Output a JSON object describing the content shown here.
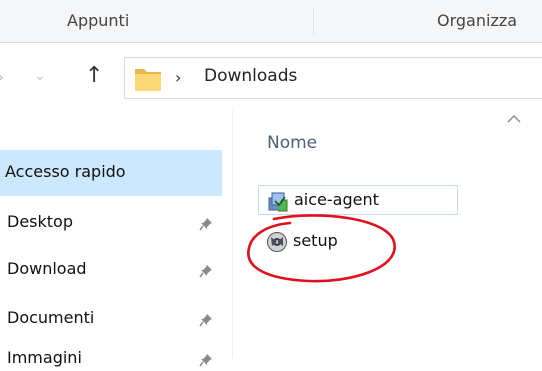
{
  "ribbon": {
    "tabs": [
      "Appunti",
      "Organizza"
    ]
  },
  "toolbar": {
    "back": "›",
    "forward": "⌄",
    "up": "↑"
  },
  "address": {
    "separator": "›",
    "path": "Downloads"
  },
  "nav": {
    "items": [
      {
        "label": "Accesso rapido",
        "selected": true,
        "pinned": false
      },
      {
        "label": "Desktop",
        "pinned": true
      },
      {
        "label": "Download",
        "pinned": true
      },
      {
        "label": "Documenti",
        "pinned": true
      },
      {
        "label": "Immagini",
        "pinned": true
      }
    ]
  },
  "files": {
    "column_name": "Nome",
    "sort_indicator": "^",
    "rows": [
      {
        "name": "aice-agent",
        "icon": "installer-package-icon"
      },
      {
        "name": "setup",
        "icon": "setup-disc-icon",
        "annotated": true
      }
    ]
  },
  "annotation": {
    "color": "#e0101e"
  }
}
